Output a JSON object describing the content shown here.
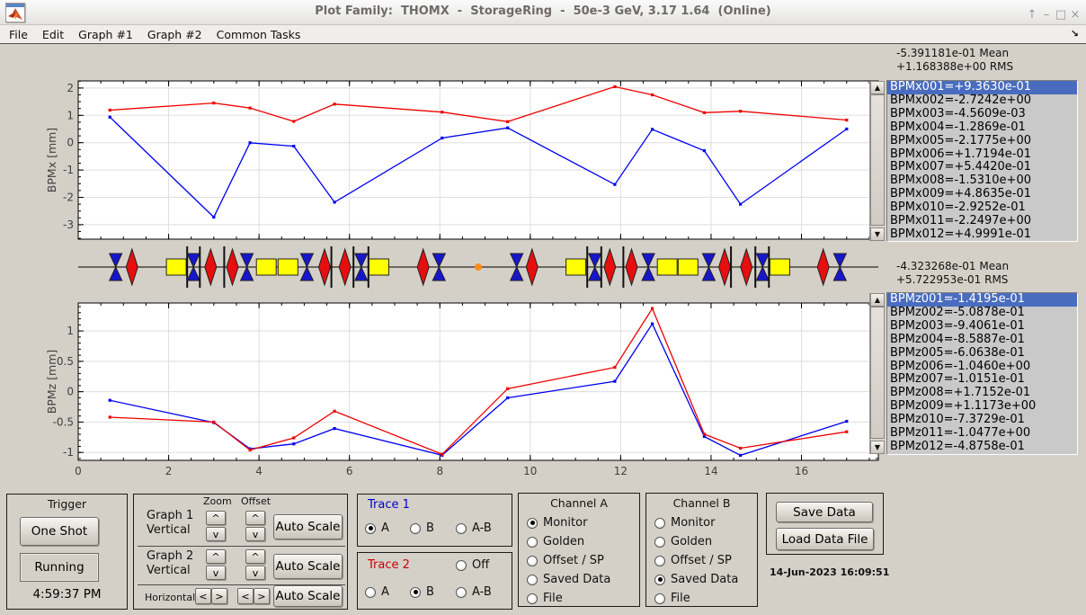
{
  "titlebar": {
    "title": "Plot Family:  THOMX  -  StorageRing  -  50e-3 GeV, 3.17 1.64  (Online)",
    "controls": [
      {
        "name": "float-icon",
        "glyph": "↑"
      },
      {
        "name": "minimize-icon",
        "glyph": "–"
      },
      {
        "name": "maximize-icon",
        "glyph": "□"
      },
      {
        "name": "close-icon",
        "glyph": "×"
      }
    ]
  },
  "menubar": {
    "items": [
      "File",
      "Edit",
      "Graph #1",
      "Graph #2",
      "Common Tasks"
    ],
    "dock_icon_glyph": "↘"
  },
  "colors": {
    "trace1": "#0000ee",
    "trace2": "#ee0000",
    "quad_blue": "#1616cc",
    "dipole_red": "#e60e0e",
    "corrector_yellow": "#ffff00",
    "bpm_black": "#111111",
    "marker_orange": "#ff8c1a",
    "selection_blue": "#4a6cbf",
    "background": "#d4d0c7"
  },
  "chart_data": [
    {
      "type": "line",
      "title": "",
      "xlabel": "",
      "ylabel": "BPMx [mm]",
      "x": [
        0.7,
        3.0,
        3.8,
        4.77,
        5.67,
        8.05,
        9.5,
        11.87,
        12.7,
        13.85,
        14.65,
        17.0
      ],
      "series": [
        {
          "name": "Trace 1 (Channel A: Monitor)",
          "color": "#0000ee",
          "values": [
            0.9363,
            -2.7242,
            -0.0046,
            -0.1287,
            -2.1775,
            0.1719,
            0.5442,
            -1.531,
            0.4864,
            -0.2925,
            -2.2497,
            0.4999
          ]
        },
        {
          "name": "Trace 2 (Channel B: Saved Data)",
          "color": "#ee0000",
          "values": [
            1.19,
            1.45,
            1.27,
            0.78,
            1.41,
            1.12,
            0.77,
            2.05,
            1.75,
            1.1,
            1.15,
            0.83
          ]
        }
      ],
      "xlim": [
        0,
        17.7
      ],
      "ylim": [
        -3.53,
        2.26
      ],
      "xticks": [
        0,
        2,
        4,
        6,
        8,
        10,
        12,
        14,
        16
      ],
      "yticks": [
        -3,
        -2,
        -1,
        0,
        1,
        2
      ],
      "xminor": 0.5,
      "yminor": 0.25,
      "grid": true,
      "legend": "none",
      "show_x_labels": false
    },
    {
      "type": "line",
      "title": "",
      "xlabel": "",
      "ylabel": "BPMz [mm]",
      "x": [
        0.7,
        3.0,
        3.8,
        4.77,
        5.67,
        8.05,
        9.5,
        11.87,
        12.7,
        13.85,
        14.65,
        17.0
      ],
      "series": [
        {
          "name": "Trace 1 (Channel A: Monitor)",
          "color": "#0000ee",
          "values": [
            -0.14195,
            -0.50878,
            -0.94061,
            -0.85887,
            -0.60638,
            -1.046,
            -0.10151,
            0.17152,
            1.1173,
            -0.73729,
            -1.0477,
            -0.48758
          ]
        },
        {
          "name": "Trace 2 (Channel B: Saved Data)",
          "color": "#ee0000",
          "values": [
            -0.42,
            -0.5,
            -0.96,
            -0.76,
            -0.32,
            -1.03,
            0.05,
            0.4,
            1.37,
            -0.7,
            -0.93,
            -0.66
          ]
        }
      ],
      "xlim": [
        0,
        17.7
      ],
      "ylim": [
        -1.13,
        1.46
      ],
      "xticks": [
        0,
        2,
        4,
        6,
        8,
        10,
        12,
        14,
        16
      ],
      "yticks": [
        -1,
        -0.5,
        0,
        0.5,
        1
      ],
      "xminor": 0.5,
      "yminor": 0.1,
      "grid": true,
      "legend": "none",
      "show_x_labels": true
    }
  ],
  "lattice": {
    "xlim": [
      0,
      17.7
    ],
    "elements": [
      {
        "t": "quad",
        "x": 0.83
      },
      {
        "t": "dipole",
        "x": 1.19
      },
      {
        "t": "corrector",
        "x": 2.17
      },
      {
        "t": "bpm",
        "x": 2.41
      },
      {
        "t": "quad",
        "x": 2.55
      },
      {
        "t": "bpm",
        "x": 2.69
      },
      {
        "t": "dipole",
        "x": 2.93
      },
      {
        "t": "bpm",
        "x": 3.23
      },
      {
        "t": "dipole",
        "x": 3.41
      },
      {
        "t": "quad",
        "x": 3.73
      },
      {
        "t": "corrector",
        "x": 4.16
      },
      {
        "t": "corrector",
        "x": 4.64
      },
      {
        "t": "quad",
        "x": 5.06
      },
      {
        "t": "dipole",
        "x": 5.45
      },
      {
        "t": "bpm",
        "x": 5.6
      },
      {
        "t": "dipole",
        "x": 5.9
      },
      {
        "t": "bpm",
        "x": 6.09
      },
      {
        "t": "quad",
        "x": 6.26
      },
      {
        "t": "bpm",
        "x": 6.42
      },
      {
        "t": "corrector",
        "x": 6.65
      },
      {
        "t": "dipole",
        "x": 7.63
      },
      {
        "t": "quad",
        "x": 7.98
      },
      {
        "t": "marker",
        "x": 8.85
      },
      {
        "t": "quad",
        "x": 9.7
      },
      {
        "t": "dipole",
        "x": 10.04
      },
      {
        "t": "corrector",
        "x": 11.01
      },
      {
        "t": "bpm",
        "x": 11.26
      },
      {
        "t": "quad",
        "x": 11.43
      },
      {
        "t": "bpm",
        "x": 11.57
      },
      {
        "t": "dipole",
        "x": 11.76
      },
      {
        "t": "bpm",
        "x": 12.06
      },
      {
        "t": "dipole",
        "x": 12.24
      },
      {
        "t": "quad",
        "x": 12.61
      },
      {
        "t": "corrector",
        "x": 13.03
      },
      {
        "t": "corrector",
        "x": 13.49
      },
      {
        "t": "quad",
        "x": 13.95
      },
      {
        "t": "dipole",
        "x": 14.3
      },
      {
        "t": "bpm",
        "x": 14.44
      },
      {
        "t": "dipole",
        "x": 14.78
      },
      {
        "t": "bpm",
        "x": 14.98
      },
      {
        "t": "quad",
        "x": 15.14
      },
      {
        "t": "bpm",
        "x": 15.28
      },
      {
        "t": "corrector",
        "x": 15.52
      },
      {
        "t": "dipole",
        "x": 16.48
      },
      {
        "t": "quad",
        "x": 16.85
      }
    ]
  },
  "stats_x": {
    "mean": "-5.391181e-01 Mean",
    "rms": "+1.168388e+00 RMS"
  },
  "stats_z": {
    "mean": "-4.323268e-01 Mean",
    "rms": "+5.722953e-01 RMS"
  },
  "listbox_x": {
    "selected_index": 0,
    "items": [
      "BPMx001=+9.3630e-01",
      "BPMx002=-2.7242e+00",
      "BPMx003=-4.5609e-03",
      "BPMx004=-1.2869e-01",
      "BPMx005=-2.1775e+00",
      "BPMx006=+1.7194e-01",
      "BPMx007=+5.4420e-01",
      "BPMx008=-1.5310e+00",
      "BPMx009=+4.8635e-01",
      "BPMx010=-2.9252e-01",
      "BPMx011=-2.2497e+00",
      "BPMx012=+4.9991e-01"
    ]
  },
  "listbox_z": {
    "selected_index": 0,
    "items": [
      "BPMz001=-1.4195e-01",
      "BPMz002=-5.0878e-01",
      "BPMz003=-9.4061e-01",
      "BPMz004=-8.5887e-01",
      "BPMz005=-6.0638e-01",
      "BPMz006=-1.0460e+00",
      "BPMz007=-1.0151e-01",
      "BPMz008=+1.7152e-01",
      "BPMz009=+1.1173e+00",
      "BPMz010=-7.3729e-01",
      "BPMz011=-1.0477e+00",
      "BPMz012=-4.8758e-01"
    ]
  },
  "trigger": {
    "title": "Trigger",
    "one_shot": "One Shot",
    "running": "Running",
    "time": "4:59:37 PM"
  },
  "zoom_offset": {
    "zoom_label": "Zoom",
    "offset_label": "Offset",
    "row1": {
      "line1": "Graph 1",
      "line2": "Vertical"
    },
    "row2": {
      "line1": "Graph 2",
      "line2": "Vertical"
    },
    "horizontal_label": "Horizontal",
    "auto_scale": "Auto Scale",
    "up": "^",
    "down": "v",
    "left": "<",
    "right": ">"
  },
  "trace1": {
    "title": "Trace 1",
    "options": [
      "A",
      "B",
      "A-B"
    ],
    "selected": "A"
  },
  "trace2": {
    "title": "Trace 2",
    "options": [
      "Off",
      "A",
      "B",
      "A-B"
    ],
    "selected": "B"
  },
  "channel_a": {
    "title": "Channel A",
    "options": [
      "Monitor",
      "Golden",
      "Offset / SP",
      "Saved Data",
      "File"
    ],
    "selected": "Monitor"
  },
  "channel_b": {
    "title": "Channel B",
    "options": [
      "Monitor",
      "Golden",
      "Offset / SP",
      "Saved Data",
      "File"
    ],
    "selected": "Saved Data"
  },
  "save_panel": {
    "save": "Save Data",
    "load": "Load Data File"
  },
  "datetime": "14-Jun-2023 16:09:51"
}
